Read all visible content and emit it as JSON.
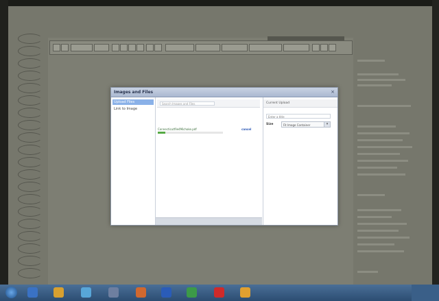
{
  "modal": {
    "title": "Images and Files",
    "close_label": "×",
    "nav": [
      {
        "label": "Upload Files"
      },
      {
        "label": "Link to Image"
      }
    ],
    "search_placeholder": "Search Images and Files",
    "file": {
      "name": "Connecticutfile4Michoke.pdf",
      "action": "cancel",
      "progress_fraction": 0.12
    },
    "right_panel": {
      "header": "Current Upload",
      "field_value": "Enter a title",
      "size_label": "Size",
      "size_value": "Fit Image Container"
    }
  },
  "colors": {
    "accent": "#8ab1e8",
    "progress": "#55a943",
    "action_link": "#2855b5"
  },
  "icons": [
    "close-icon",
    "chevron-down-icon",
    "start-icon",
    "word-icon",
    "excel-icon",
    "acrobat-icon",
    "chrome-icon"
  ]
}
